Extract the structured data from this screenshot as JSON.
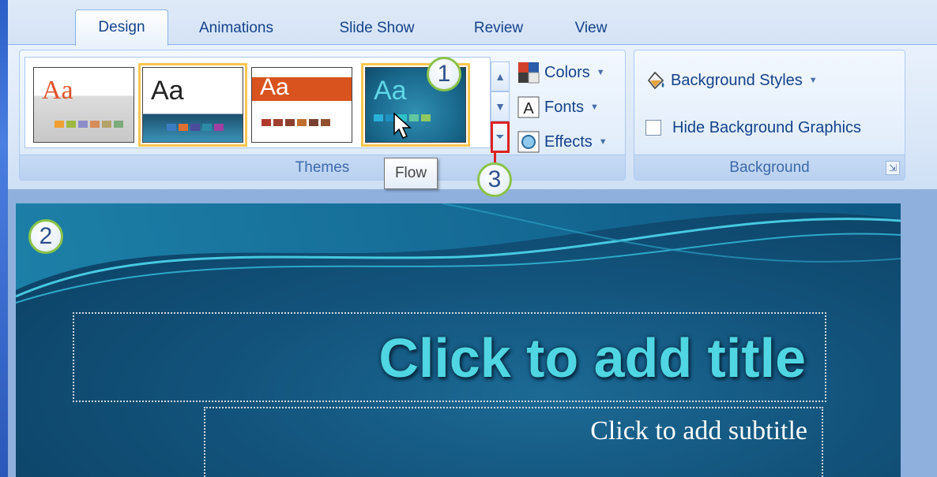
{
  "tabs": [
    {
      "label": "Design",
      "active": true
    },
    {
      "label": "Animations"
    },
    {
      "label": "Slide Show"
    },
    {
      "label": "Review"
    },
    {
      "label": "View"
    }
  ],
  "themes_group": {
    "label": "Themes",
    "thumbnails": [
      {
        "text": "Aa",
        "name": "theme-1"
      },
      {
        "text": "Aa",
        "name": "theme-2"
      },
      {
        "text": "Aa",
        "name": "theme-3"
      },
      {
        "text": "Aa",
        "name": "Flow",
        "hovered": true
      }
    ],
    "commands": {
      "colors": "Colors",
      "fonts": "Fonts",
      "effects": "Effects"
    },
    "tooltip": "Flow"
  },
  "background_group": {
    "label": "Background",
    "styles": "Background Styles",
    "hide_graphics": "Hide Background Graphics",
    "hide_graphics_checked": false
  },
  "callouts": {
    "one": "1",
    "two": "2",
    "three": "3"
  },
  "slide": {
    "title_placeholder": "Click to add title",
    "subtitle_placeholder": "Click to add subtitle"
  },
  "colors": {
    "accent_title": "#4fd6e2",
    "selection_border": "#f9c64f",
    "callout_ring": "#8bc34a",
    "more_button_highlight": "#dd2222"
  }
}
